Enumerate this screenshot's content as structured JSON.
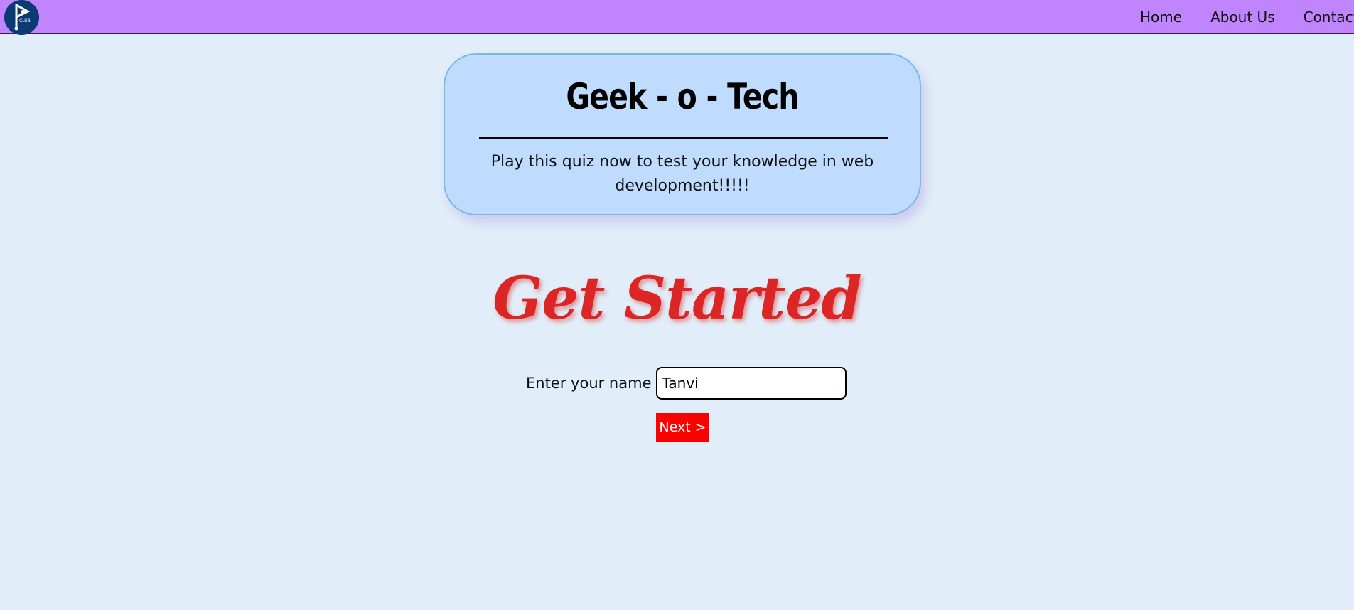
{
  "nav": {
    "logo_text": "CLUB",
    "links": [
      "Home",
      "About Us",
      "Contact"
    ]
  },
  "hero": {
    "title": "Geek - o - Tech",
    "subtitle": "Play this quiz now to test your knowledge in web development!!!!!"
  },
  "main": {
    "heading": "Get Started",
    "name_label": "Enter your name",
    "name_value": "Tanvi",
    "next_label": "Next >"
  },
  "colors": {
    "navbar": "#c084fc",
    "page_bg": "#e1edf8",
    "card_bg": "#bfdbfe",
    "heading": "#dc2626",
    "button": "#ff0000"
  }
}
